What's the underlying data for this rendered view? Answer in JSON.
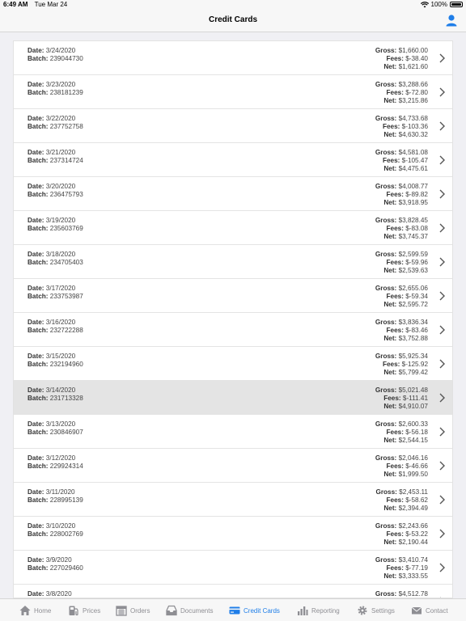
{
  "status": {
    "time": "6:49 AM",
    "date": "Tue Mar 24",
    "battery": "100%"
  },
  "nav": {
    "title": "Credit Cards"
  },
  "labels": {
    "date": "Date:",
    "batch": "Batch:",
    "gross": "Gross:",
    "fees": "Fees:",
    "net": "Net:"
  },
  "rows": [
    {
      "date": "3/24/2020",
      "batch": "239044730",
      "gross": "$1,660.00",
      "fees": "$-38.40",
      "net": "$1,621.60"
    },
    {
      "date": "3/23/2020",
      "batch": "238181239",
      "gross": "$3,288.66",
      "fees": "$-72.80",
      "net": "$3,215.86"
    },
    {
      "date": "3/22/2020",
      "batch": "237752758",
      "gross": "$4,733.68",
      "fees": "$-103.36",
      "net": "$4,630.32"
    },
    {
      "date": "3/21/2020",
      "batch": "237314724",
      "gross": "$4,581.08",
      "fees": "$-105.47",
      "net": "$4,475.61"
    },
    {
      "date": "3/20/2020",
      "batch": "236475793",
      "gross": "$4,008.77",
      "fees": "$-89.82",
      "net": "$3,918.95"
    },
    {
      "date": "3/19/2020",
      "batch": "235603769",
      "gross": "$3,828.45",
      "fees": "$-83.08",
      "net": "$3,745.37"
    },
    {
      "date": "3/18/2020",
      "batch": "234705403",
      "gross": "$2,599.59",
      "fees": "$-59.96",
      "net": "$2,539.63"
    },
    {
      "date": "3/17/2020",
      "batch": "233753987",
      "gross": "$2,655.06",
      "fees": "$-59.34",
      "net": "$2,595.72"
    },
    {
      "date": "3/16/2020",
      "batch": "232722288",
      "gross": "$3,836.34",
      "fees": "$-83.46",
      "net": "$3,752.88"
    },
    {
      "date": "3/15/2020",
      "batch": "232194960",
      "gross": "$5,925.34",
      "fees": "$-125.92",
      "net": "$5,799.42"
    },
    {
      "date": "3/14/2020",
      "batch": "231713328",
      "gross": "$5,021.48",
      "fees": "$-111.41",
      "net": "$4,910.07",
      "selected": true
    },
    {
      "date": "3/13/2020",
      "batch": "230846907",
      "gross": "$2,600.33",
      "fees": "$-56.18",
      "net": "$2,544.15"
    },
    {
      "date": "3/12/2020",
      "batch": "229924314",
      "gross": "$2,046.16",
      "fees": "$-46.66",
      "net": "$1,999.50"
    },
    {
      "date": "3/11/2020",
      "batch": "228995139",
      "gross": "$2,453.11",
      "fees": "$-58.62",
      "net": "$2,394.49"
    },
    {
      "date": "3/10/2020",
      "batch": "228002769",
      "gross": "$2,243.66",
      "fees": "$-53.22",
      "net": "$2,190.44"
    },
    {
      "date": "3/9/2020",
      "batch": "227029460",
      "gross": "$3,410.74",
      "fees": "$-77.19",
      "net": "$3,333.55"
    },
    {
      "date": "3/8/2020",
      "batch": "",
      "gross": "$4,512.78",
      "fees": "",
      "net": ""
    }
  ],
  "tabs": [
    {
      "label": "Home",
      "icon": "home-icon",
      "active": false
    },
    {
      "label": "Prices",
      "icon": "fuel-pump-icon",
      "active": false
    },
    {
      "label": "Orders",
      "icon": "calendar-icon",
      "active": false
    },
    {
      "label": "Documents",
      "icon": "inbox-tray-icon",
      "active": false
    },
    {
      "label": "Credit Cards",
      "icon": "credit-card-icon",
      "active": true
    },
    {
      "label": "Reporting",
      "icon": "bar-chart-icon",
      "active": false
    },
    {
      "label": "Settings",
      "icon": "gear-icon",
      "active": false
    },
    {
      "label": "Contact",
      "icon": "envelope-icon",
      "active": false
    }
  ],
  "colors": {
    "accent": "#1f7ee8",
    "inactive": "#8e8e93",
    "selected_row": "#e4e4e4"
  }
}
